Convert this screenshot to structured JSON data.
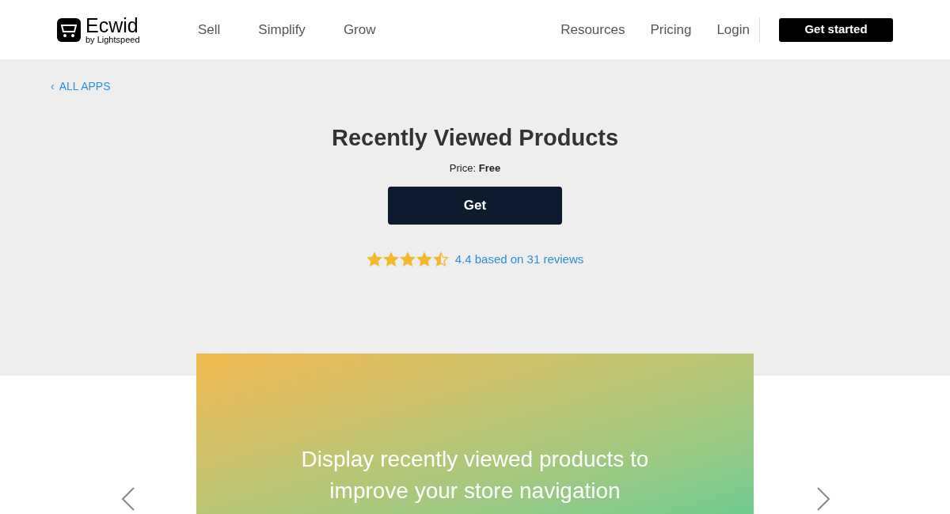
{
  "header": {
    "logo": {
      "name": "Ecwid",
      "tagline": "by Lightspeed"
    },
    "nav_left": [
      "Sell",
      "Simplify",
      "Grow"
    ],
    "nav_right": [
      "Resources",
      "Pricing",
      "Login"
    ],
    "cta": "Get started"
  },
  "back_link": {
    "icon": "‹",
    "label": "ALL APPS"
  },
  "app": {
    "title": "Recently Viewed Products",
    "price_label": "Price:",
    "price": "Free",
    "button": "Get",
    "stars": 4.5,
    "rating_text": "4.4 based on 31 reviews"
  },
  "banner": {
    "text": "Display recently viewed products to improve your store navigation"
  }
}
